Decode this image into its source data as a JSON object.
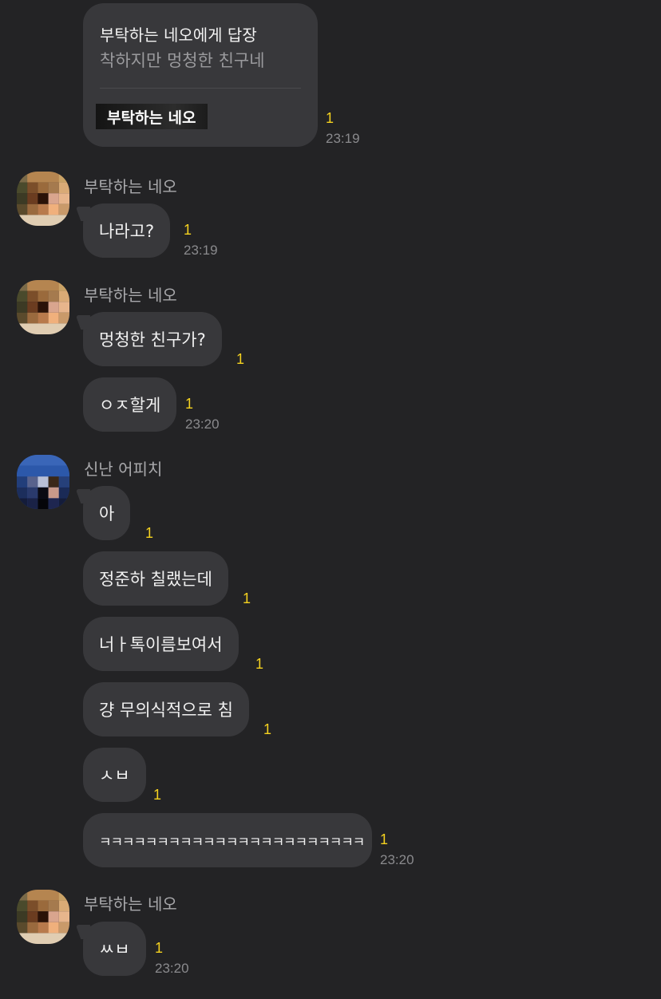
{
  "reply": {
    "title": "부탁하는 네오에게 답장",
    "quote": "착하지만 멍청한 친구네",
    "target_name": "부탁하는 네오",
    "unread": "1",
    "time": "23:19"
  },
  "groups": [
    {
      "sender": "부탁하는 네오",
      "avatar_icon": "neo-avatar-icon",
      "messages": [
        {
          "text": "나라고?",
          "unread": "1",
          "time": "23:19"
        }
      ]
    },
    {
      "sender": "부탁하는 네오",
      "avatar_icon": "neo-avatar-icon",
      "messages": [
        {
          "text": "멍청한 친구가?",
          "unread": "1",
          "time": ""
        },
        {
          "text": "ㅇㅈ할게",
          "unread": "1",
          "time": "23:20"
        }
      ]
    },
    {
      "sender": "신난 어피치",
      "avatar_icon": "apeach-avatar-icon",
      "messages": [
        {
          "text": "아",
          "unread": "1",
          "time": ""
        },
        {
          "text": "정준하 칠랬는데",
          "unread": "1",
          "time": ""
        },
        {
          "text": "너ㅏ톡이름보여서",
          "unread": "1",
          "time": ""
        },
        {
          "text": "걍 무의식적으로 침",
          "unread": "1",
          "time": ""
        },
        {
          "text": "ㅅㅂ",
          "unread": "1",
          "time": ""
        },
        {
          "text": "ㅋㅋㅋㅋㅋㅋㅋㅋㅋㅋㅋㅋㅋㅋㅋㅋㅋㅋㅋㅋㅋㅋㅋ",
          "unread": "1",
          "time": "23:20"
        }
      ]
    },
    {
      "sender": "부탁하는 네오",
      "avatar_icon": "neo-avatar-icon",
      "messages": [
        {
          "text": "ㅆㅂ",
          "unread": "1",
          "time": "23:20"
        }
      ]
    }
  ]
}
